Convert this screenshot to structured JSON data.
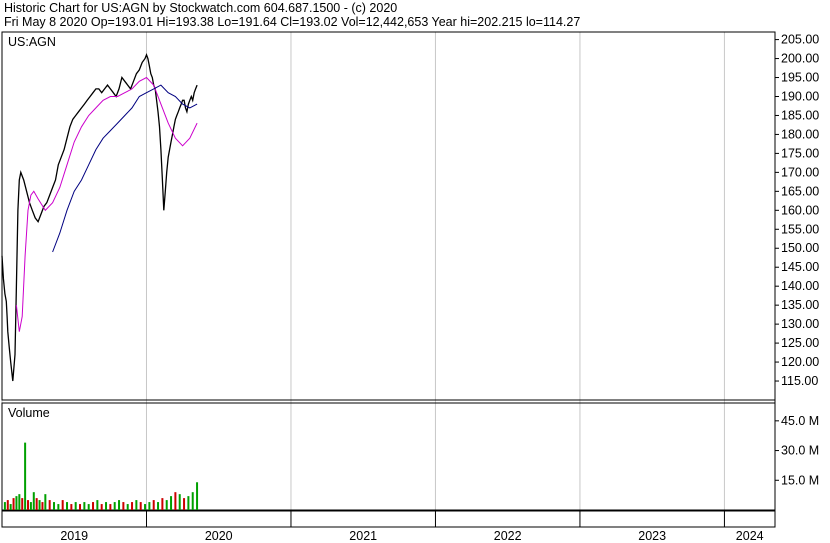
{
  "header": {
    "line1": "Historic Chart for US:AGN by Stockwatch.com 604.687.1500 - (c) 2020",
    "line2": "Fri May  8 2020   Op=193.01   Hi=193.38   Lo=191.64   Cl=193.02   Vol=12,442,653   Year hi=202.215   lo=114.27"
  },
  "colors": {
    "price": "#000000",
    "ma_short": "#cc00cc",
    "ma_long": "#000080",
    "vol_up": "#00a000",
    "vol_down": "#cc0000",
    "grid": "#c8c8c8"
  },
  "chart_data": [
    {
      "type": "line",
      "title": "US:AGN",
      "ylim": [
        110,
        207
      ],
      "y_ticks": [
        "205.00",
        "200.00",
        "195.00",
        "190.00",
        "185.00",
        "180.00",
        "175.00",
        "170.00",
        "165.00",
        "160.00",
        "155.00",
        "150.00",
        "145.00",
        "140.00",
        "135.00",
        "130.00",
        "125.00",
        "120.00",
        "115.00"
      ],
      "x_ticks": [
        "2019",
        "2020",
        "2021",
        "2022",
        "2023",
        "2024"
      ],
      "series": [
        {
          "key": "price",
          "x": [
            2019.0,
            2019.01,
            2019.02,
            2019.03,
            2019.035,
            2019.04,
            2019.05,
            2019.06,
            2019.075,
            2019.09,
            2019.1,
            2019.11,
            2019.12,
            2019.13,
            2019.15,
            2019.17,
            2019.19,
            2019.21,
            2019.23,
            2019.25,
            2019.27,
            2019.29,
            2019.31,
            2019.33,
            2019.35,
            2019.37,
            2019.39,
            2019.41,
            2019.43,
            2019.45,
            2019.47,
            2019.49,
            2019.51,
            2019.53,
            2019.55,
            2019.57,
            2019.59,
            2019.61,
            2019.63,
            2019.65,
            2019.67,
            2019.69,
            2019.71,
            2019.73,
            2019.75,
            2019.77,
            2019.79,
            2019.81,
            2019.83,
            2019.85,
            2019.87,
            2019.89,
            2019.91,
            2019.93,
            2019.95,
            2019.97,
            2019.99,
            2020.0,
            2020.01,
            2020.02,
            2020.03,
            2020.04,
            2020.05,
            2020.06,
            2020.07,
            2020.08,
            2020.09,
            2020.1,
            2020.11,
            2020.12,
            2020.13,
            2020.14,
            2020.15,
            2020.16,
            2020.17,
            2020.18,
            2020.19,
            2020.2,
            2020.21,
            2020.22,
            2020.23,
            2020.24,
            2020.25,
            2020.26,
            2020.27,
            2020.28,
            2020.29,
            2020.3,
            2020.31,
            2020.32,
            2020.33,
            2020.34,
            2020.35
          ],
          "values": [
            148,
            142,
            138,
            136,
            132,
            128,
            124,
            120,
            115,
            122,
            140,
            160,
            168,
            170,
            168,
            165,
            162,
            160,
            158,
            157,
            159,
            161,
            162,
            164,
            166,
            168,
            172,
            174,
            176,
            179,
            182,
            184,
            185,
            186,
            187,
            188,
            189,
            190,
            191,
            192,
            192,
            191,
            192,
            193,
            192,
            191,
            190,
            192,
            195,
            194,
            193,
            192,
            194,
            196,
            197,
            199,
            200,
            201,
            200,
            198,
            196,
            195,
            193,
            192,
            189,
            186,
            182,
            176,
            168,
            160,
            165,
            170,
            174,
            176,
            178,
            180,
            182,
            184,
            185,
            186,
            187,
            188,
            189,
            189,
            187,
            186,
            188,
            189,
            190,
            189,
            191,
            192,
            193
          ]
        },
        {
          "key": "ma_short",
          "x": [
            2019.1,
            2019.12,
            2019.14,
            2019.16,
            2019.18,
            2019.2,
            2019.22,
            2019.25,
            2019.3,
            2019.35,
            2019.4,
            2019.45,
            2019.5,
            2019.55,
            2019.6,
            2019.65,
            2019.7,
            2019.75,
            2019.8,
            2019.85,
            2019.9,
            2019.95,
            2020.0,
            2020.05,
            2020.1,
            2020.15,
            2020.2,
            2020.25,
            2020.3,
            2020.35
          ],
          "values": [
            135,
            128,
            132,
            148,
            160,
            164,
            165,
            163,
            160,
            162,
            166,
            172,
            178,
            182,
            185,
            187,
            189,
            190,
            190,
            191,
            192,
            194,
            195,
            193,
            188,
            183,
            179,
            177,
            179,
            183
          ]
        },
        {
          "key": "ma_long",
          "x": [
            2019.35,
            2019.4,
            2019.45,
            2019.5,
            2019.55,
            2019.6,
            2019.65,
            2019.7,
            2019.75,
            2019.8,
            2019.85,
            2019.9,
            2019.95,
            2020.0,
            2020.05,
            2020.1,
            2020.15,
            2020.2,
            2020.25,
            2020.3,
            2020.35
          ],
          "values": [
            149,
            154,
            160,
            165,
            168,
            172,
            176,
            179,
            181,
            183,
            185,
            187,
            190,
            191,
            192,
            193,
            191,
            190,
            188,
            187,
            188
          ]
        }
      ]
    },
    {
      "type": "bar",
      "title": "Volume",
      "ylim": [
        0,
        54
      ],
      "y_ticks": [
        "45.0 M",
        "30.0 M",
        "15.0 M"
      ],
      "x": [
        2019.02,
        2019.04,
        2019.06,
        2019.08,
        2019.1,
        2019.12,
        2019.14,
        2019.16,
        2019.18,
        2019.2,
        2019.22,
        2019.24,
        2019.26,
        2019.28,
        2019.3,
        2019.33,
        2019.36,
        2019.39,
        2019.42,
        2019.45,
        2019.48,
        2019.51,
        2019.54,
        2019.57,
        2019.6,
        2019.63,
        2019.66,
        2019.69,
        2019.72,
        2019.75,
        2019.78,
        2019.81,
        2019.84,
        2019.87,
        2019.9,
        2019.93,
        2019.96,
        2019.99,
        2020.02,
        2020.05,
        2020.08,
        2020.11,
        2020.14,
        2020.17,
        2020.2,
        2020.23,
        2020.26,
        2020.29,
        2020.32,
        2020.35
      ],
      "values": [
        4,
        5,
        3,
        6,
        7,
        8,
        6,
        34,
        5,
        4,
        9,
        6,
        5,
        4,
        8,
        5,
        4,
        3,
        5,
        4,
        3,
        4,
        3,
        4,
        3,
        4,
        5,
        3,
        4,
        3,
        4,
        5,
        4,
        3,
        4,
        5,
        4,
        3,
        4,
        5,
        4,
        6,
        5,
        7,
        9,
        8,
        6,
        7,
        9,
        14
      ],
      "up": [
        1,
        0,
        1,
        0,
        1,
        1,
        0,
        1,
        0,
        1,
        1,
        0,
        1,
        0,
        1,
        0,
        1,
        1,
        0,
        1,
        0,
        1,
        0,
        1,
        1,
        0,
        1,
        0,
        1,
        0,
        1,
        1,
        0,
        1,
        0,
        1,
        0,
        1,
        1,
        0,
        1,
        0,
        1,
        1,
        0,
        1,
        0,
        1,
        1,
        1
      ]
    }
  ]
}
